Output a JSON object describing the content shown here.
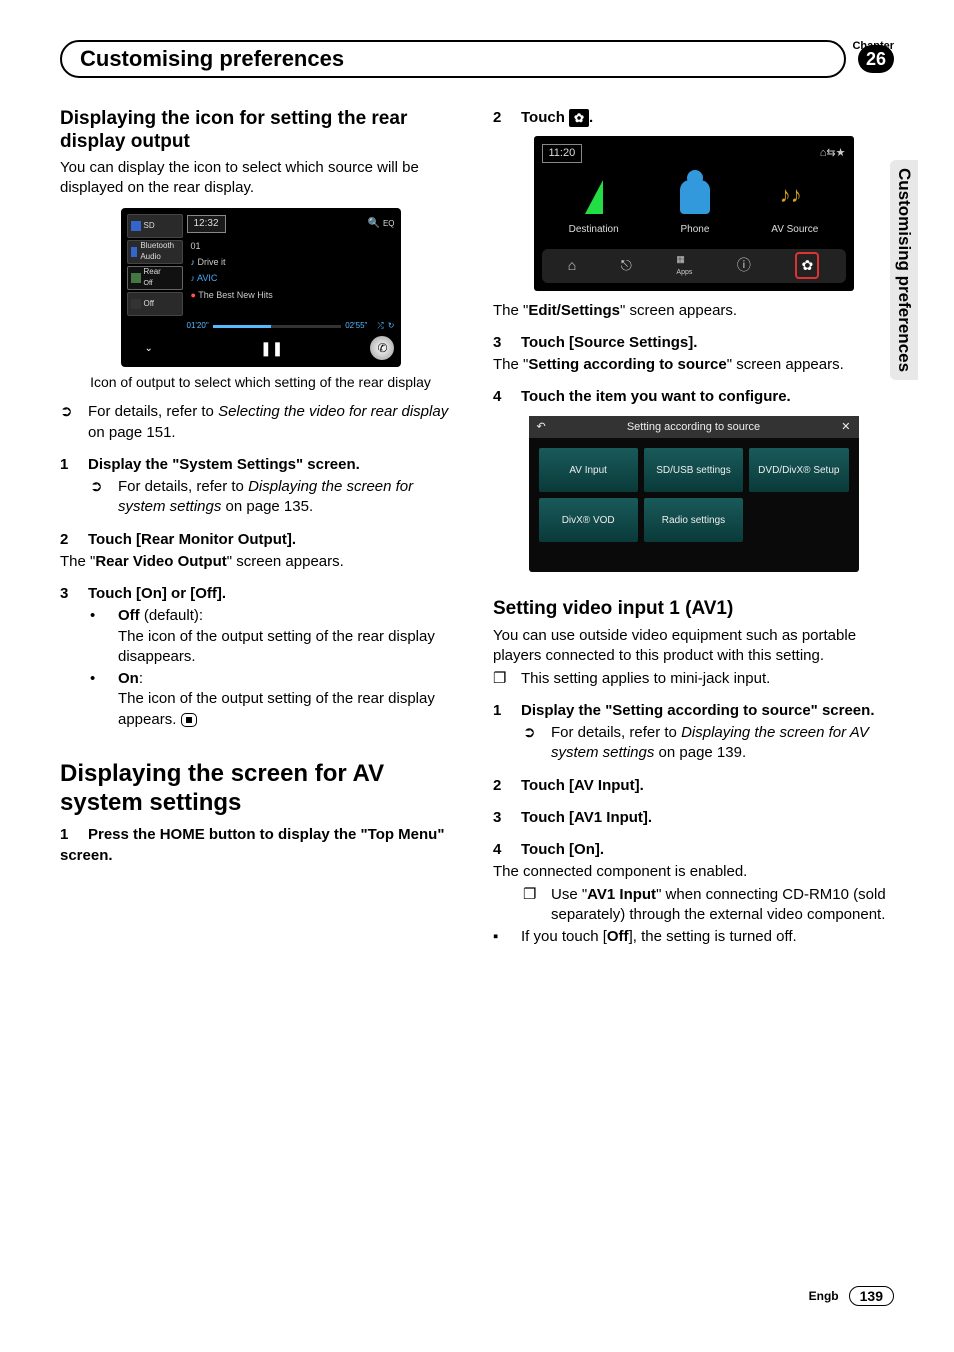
{
  "header": {
    "chapter_label": "Chapter",
    "title": "Customising preferences",
    "chapter_number": "26",
    "side_tab": "Customising preferences"
  },
  "left": {
    "h2a": "Displaying the icon for setting the rear display output",
    "intro": "You can display the icon to select which source will be displayed on the rear display.",
    "shot1": {
      "clock": "12:32",
      "side": {
        "sd": "SD",
        "bt": "Bluetooth Audio",
        "rear": "Rear",
        "rear_sub": "Off",
        "off": "Off"
      },
      "track_no": "01",
      "track": "Drive it",
      "album": "AVIC",
      "playlist": "The Best New Hits",
      "t1": "01'20\"",
      "t2": "02'55\"",
      "search": "🔍",
      "eq": "EQ"
    },
    "caption": "Icon of output to select which setting of the rear display",
    "ref1_pre": "For details, refer to ",
    "ref1_it": "Selecting the video for rear display",
    "ref1_post": " on page 151.",
    "s1_num": "1",
    "s1": "Display the \"System Settings\" screen.",
    "s1_sub_pre": "For details, refer to ",
    "s1_sub_it": "Displaying the screen for system settings",
    "s1_sub_post": " on page 135.",
    "s2_num": "2",
    "s2": "Touch [Rear Monitor Output].",
    "s2_body_a": "The \"",
    "s2_body_b": "Rear Video Output",
    "s2_body_c": "\" screen appears.",
    "s3_num": "3",
    "s3": "Touch [On] or [Off].",
    "off_label": "Off",
    "off_default": " (default):",
    "off_body": "The icon of the output setting of the rear display disappears.",
    "on_label": "On",
    "on_colon": ":",
    "on_body": "The icon of the output setting of the rear display appears.",
    "h2b": "Displaying the screen for AV system settings",
    "b1_num": "1",
    "b1": "Press the HOME button to display the \"Top Menu\" screen."
  },
  "right": {
    "s2_num": "2",
    "s2_pre": "Touch ",
    "s2_post": ".",
    "shot2": {
      "clock": "11:20",
      "items": {
        "dest": "Destination",
        "phone": "Phone",
        "av": "AV Source"
      },
      "apps": "Apps"
    },
    "s2_body_a": "The \"",
    "s2_body_b": "Edit/Settings",
    "s2_body_c": "\" screen appears.",
    "s3_num": "3",
    "s3": "Touch [Source Settings].",
    "s3_body_a": "The \"",
    "s3_body_b": "Setting according to source",
    "s3_body_c": "\" screen appears.",
    "s4_num": "4",
    "s4": "Touch the item you want to configure.",
    "shot3": {
      "title": "Setting according to source",
      "back": "↶",
      "close": "✕",
      "cells": {
        "av_input": "AV Input",
        "sd_usb": "SD/USB settings",
        "dvd": "DVD/DivX® Setup",
        "divx_vod": "DivX® VOD",
        "radio": "Radio settings"
      }
    },
    "h2": "Setting video input 1 (AV1)",
    "intro": "You can use outside video equipment such as portable players connected to this product with this setting.",
    "note1": "This setting applies to mini-jack input.",
    "r1_num": "1",
    "r1": "Display the \"Setting according to source\" screen.",
    "r1_sub_pre": "For details, refer to ",
    "r1_sub_it": "Displaying the screen for AV system settings",
    "r1_sub_post": " on page 139.",
    "r2_num": "2",
    "r2": "Touch [AV Input].",
    "r3_num": "3",
    "r3": "Touch [AV1 Input].",
    "r4_num": "4",
    "r4": "Touch [On].",
    "r4_body": "The connected component is enabled.",
    "note2_a": "Use \"",
    "note2_b": "AV1 Input",
    "note2_c": "\" when connecting CD-RM10 (sold separately) through the external video component.",
    "note3_a": "If you touch [",
    "note3_b": "Off",
    "note3_c": "], the setting is turned off."
  },
  "footer": {
    "engb": "Engb",
    "page": "139"
  }
}
